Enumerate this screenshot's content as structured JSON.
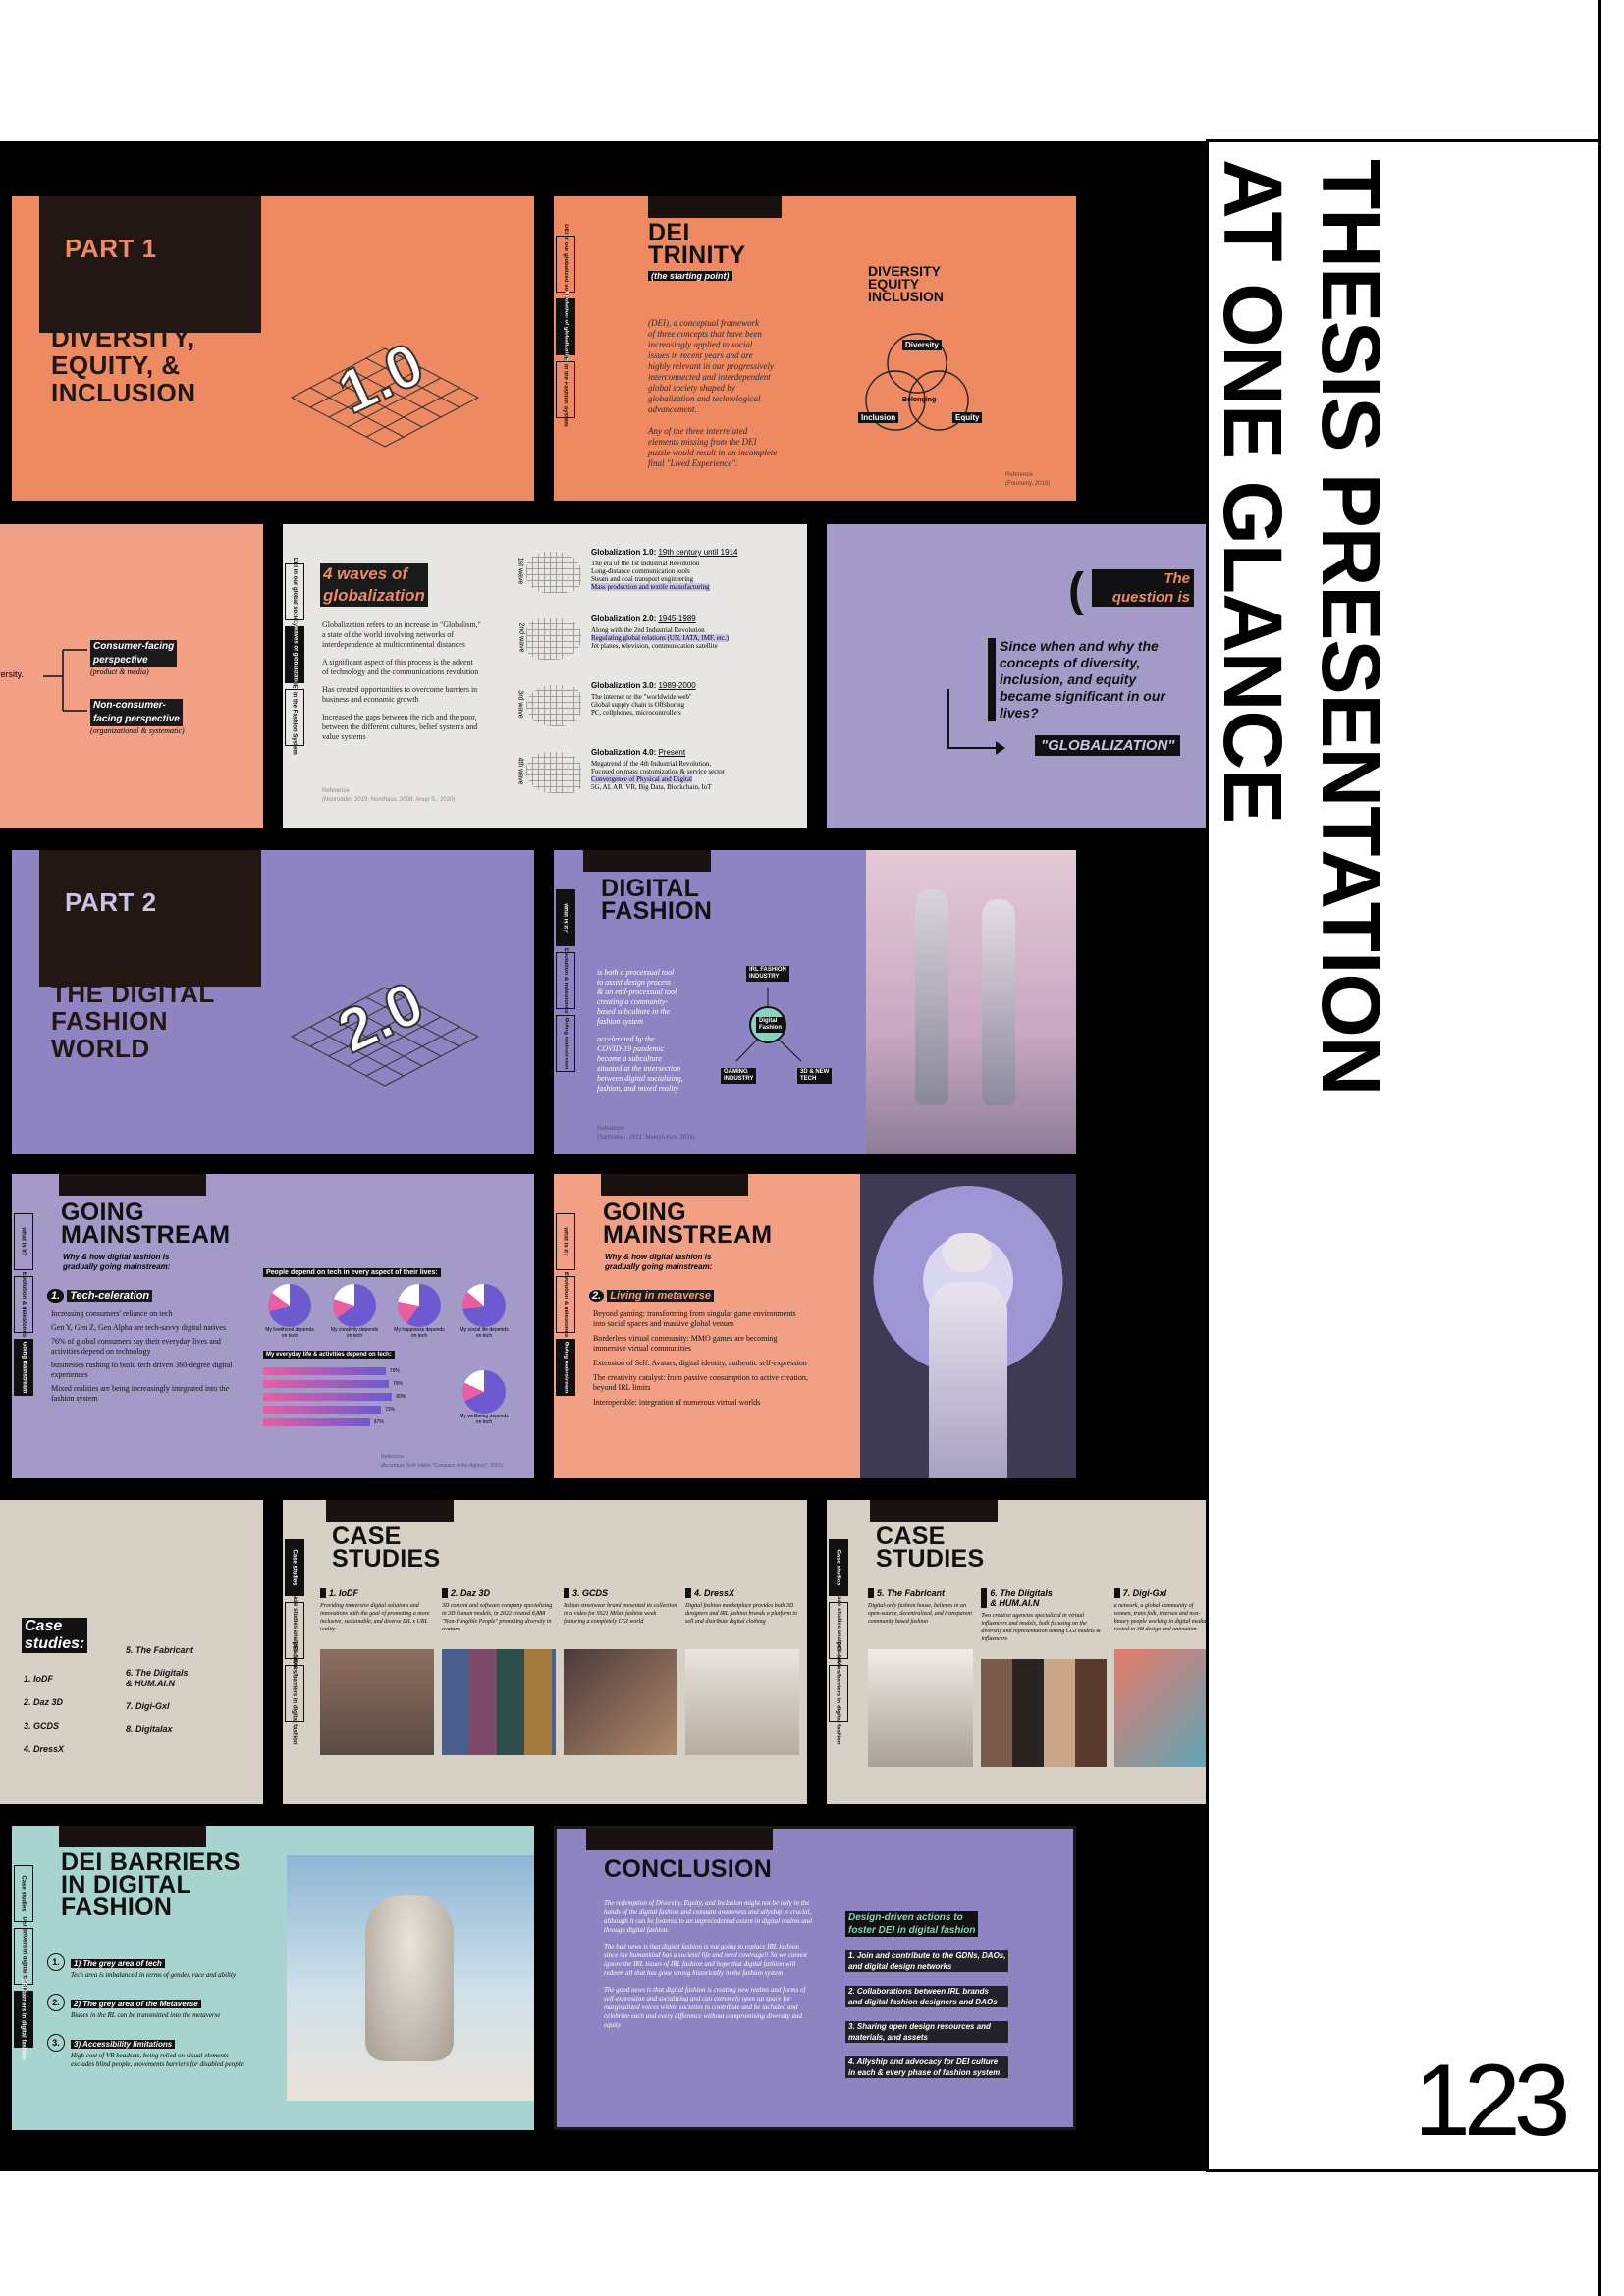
{
  "page": {
    "title_line1": "THESIS PRESENTATION",
    "title_line2": "AT ONE GLANCE",
    "page_number": "123"
  },
  "slides": {
    "s1": {
      "part": "PART 1",
      "title": "DIVERSITY,\nEQUITY, &\nINCLUSION",
      "badge": "1.0"
    },
    "s2": {
      "title": "DEI\nTRINITY",
      "subtitle": "(the starting point)",
      "body": "(DEI), a conceptual framework\nof three concepts that have been\nincreasingly applied to social\nissues in recent years and are\nhighly relevant in our progressively\ninterconnected and interdependent\nglobal society shaped by\nglobalization and technological\nadvancement.\n\nAny of the three interrelated\nelements missing from the DEI\npuzzle would result in an incomplete\nfinal \"Lived Experience\".",
      "logo_lines": [
        "DIVERSITY",
        "EQUITY",
        "INCLUSION"
      ],
      "venn": [
        "Diversity",
        "Belonging",
        "Inclusion",
        "Equity"
      ],
      "source": "Reference\n(Foumeny, 2019)",
      "side_tabs": [
        "DEI in our globalized society",
        "Evolution of globalization",
        "DEI in the Fashion System"
      ]
    },
    "s3": {
      "cut_text": "iversity.",
      "items": [
        {
          "label": "Consumer-facing\nperspective",
          "sub": "(product & media)"
        },
        {
          "label": "Non-consumer-\nfacing perspective",
          "sub": "(organizational & systematic)"
        }
      ]
    },
    "s4": {
      "title": "4 waves of\nglobalization",
      "side_tabs": [
        "DEI in our global society",
        "4 waves of globalization",
        "DEI in the Fashion System"
      ],
      "bullets": [
        "Globalization refers to an increase in \"Globalism,\" a state of the world involving networks of interdependence at multicontinental distances",
        "A significant aspect of this process is the advent of technology and the communications revolution",
        "Has created opportunities to overcome barriers in business and economic growth",
        "Increased the gaps between the rich and the poor, between the different cultures, belief systems and value systems"
      ],
      "source": "Reference\n(Nooruddin, 2019; Nordhaus, 2008; Anup S., 2020)",
      "waves": [
        {
          "label": "1st wave",
          "title": "Globalization 1.0:",
          "date": "19th century until 1914",
          "points": [
            "The era of the 1st Industrial Revolution",
            "Long-distance communication tools",
            "Steam and coal transport engineering",
            "Mass production and textile manufacturing"
          ]
        },
        {
          "label": "2nd wave",
          "title": "Globalization 2.0:",
          "date": "1945-1989",
          "points": [
            "Along with the 2nd Industrial Revolution",
            "Regulating global relations (UN, IATA, IMF, etc.)",
            "Jet planes, television, communication satellite"
          ]
        },
        {
          "label": "3rd wave",
          "title": "Globalization 3.0:",
          "date": "1989-2000",
          "points": [
            "The internet or the \"worldwide web\"",
            "Global supply chain is Offshoring",
            "PC, cellphones, microcontrollers"
          ]
        },
        {
          "label": "4th wave",
          "title": "Globalization 4.0:",
          "date": "Present",
          "points": [
            "Megatrend of the 4th Industrial Revolution,",
            "Focused on mass customization & service sector",
            "Convergence of Physical and Digital",
            "5G, AI, AR, VR, Big Data, Blockchain, IoT"
          ]
        }
      ]
    },
    "s5": {
      "tag": "The\nquestion is",
      "question": "Since when and why the\nconcepts of diversity,\ninclusion, and equity\nbecame significant in our\nlives?",
      "answer": "\"GLOBALIZATION\""
    },
    "s6": {
      "part": "PART 2",
      "title": "THE DIGITAL\nFASHION\nWORLD",
      "badge": "2.0"
    },
    "s7": {
      "title": "DIGITAL\nFASHION",
      "side_tabs": [
        "what is it?",
        "Evolution & milestones",
        "Going mainstream"
      ],
      "b1": "is both a processual tool\nto assist design process\n& an end-processual tool\ncreating a community-\nbased subculture in the\nfashion system",
      "b2": "accelerated by the\nCOVID-19 pandemic\nbecame a subculture\nsituated at the intersection\nbetween digital socializing,\nfashion, and mixed reality",
      "diagram": [
        "IRL FASHION\nINDUSTRY",
        "Digital\nFashion",
        "GAMING\nINDUSTRY",
        "3D & NEW\nTECH"
      ],
      "source": "Reference\n(Sarmakari, 2021; Makryn-Kim, 2016)"
    },
    "s8": {
      "title": "GOING\nMAINSTREAM",
      "subtitle": "Why & how digital fashion is\ngradually going mainstream:",
      "side_tabs": [
        "what is it?",
        "Evolution & milestones",
        "Going mainstream"
      ],
      "num_label": "Tech-celeration",
      "bullets": [
        "Increasing consumers' reliance on tech",
        "Gen Y, Gen Z, Gen Alpha are tech-savvy digital natives",
        "76% of global consumers say their everyday lives and activities depend on technology",
        "businesses rushing to build tech driven 360-degree digital experiences",
        "Mixed realities are being increasingly integrated into the fashion system"
      ],
      "chart_title": "People depend on tech in every aspect of their lives:",
      "donuts": [
        "My livelihood depends on tech",
        "My creativity depends on tech",
        "My happiness depends on tech",
        "My social life depends on tech"
      ],
      "bar_title": "My everyday life & activities depend on tech:",
      "bars": [
        "76%",
        "79%",
        "80%",
        "73%",
        "67%"
      ],
      "wellbeing": "My wellbeing depends on tech",
      "source": "Reference\n(Accenture Tech Vision \"Compass in the Agency\", 2021)"
    },
    "s9": {
      "title": "GOING\nMAINSTREAM",
      "subtitle": "Why & how digital fashion is\ngradually going mainstream:",
      "side_tabs": [
        "what is it?",
        "Evolution & milestones",
        "Going mainstream"
      ],
      "num_label": "Living in metaverse",
      "bullets": [
        "Beyond gaming: transforming from singular game environments into social spaces and massive global venues",
        "Borderless virtual community: MMO games are becoming immersive virtual communities",
        "Extension of Self: Avatars, digital identity, authentic self-expression",
        "The creativity catalyst: from passive consumption to active creation, beyond IRL limits",
        "Interoperable: integration of numerous virtual worlds"
      ]
    },
    "s10": {
      "title": "Case\nstudies:",
      "col1": [
        "1. IoDF",
        "2. Daz 3D",
        "3. GCDS",
        "4. DressX"
      ],
      "col2": [
        "5. The Fabricant",
        "6. The Diigitals\n& HUM.AI.N",
        "7. Digi-Gxl",
        "8. Digitalax"
      ]
    },
    "s11": {
      "title": "CASE\nSTUDIES",
      "side_tabs": [
        "Case studies",
        "Case studies analysis table",
        "DEI drivers/barriers in digital fashion"
      ],
      "cases": [
        {
          "name": "1. IoDF",
          "text": "Providing immersive digital solutions and innovations with the goal of promoting a more inclusive, sustainable, and diverse IRL x URL reality"
        },
        {
          "name": "2. Daz 3D",
          "text": "3D content and software company specializing in 3D human models, in 2022 created 8,888 \"Non-Fungible People\" promoting diversity in avatars"
        },
        {
          "name": "3. GCDS",
          "text": "Italian streetwear brand presented its collection in a video for SS21 Milan fashion week featuring a completely CGI world"
        },
        {
          "name": "4. DressX",
          "text": "Digital fashion marketplace provides both 3D designers and IRL fashion brands a platform to sell and distribute digital clothing"
        }
      ]
    },
    "s12": {
      "title": "CASE\nSTUDIES",
      "side_tabs": [
        "Case studies",
        "Case studies analysis table",
        "DEI drivers/barriers in digital fashion"
      ],
      "cases": [
        {
          "name": "5. The Fabricant",
          "text": "Digital-only fashion house, believes in an open-source, decentralized, and transparent community based fashion"
        },
        {
          "name": "6. The Diigitals\n& HUM.AI.N",
          "text": "Two creative agencies specialized in virtual influencers and models, both focusing on the diversity and representation among CGI models & influencers"
        },
        {
          "name": "7. Digi-Gxl",
          "text": "a network, a global community of women, trans folk, intersex and non-binary people working in digital media, rooted in 3D design and animation"
        }
      ]
    },
    "s13": {
      "title": "DEI BARRIERS\nIN DIGITAL\nFASHION",
      "side_tabs": [
        "Case studies",
        "DEI drivers in digital fashion",
        "DEI barriers in digital fashion"
      ],
      "items": [
        {
          "num": "1.",
          "title": "1) The grey area of tech",
          "text": "Tech area is imbalanced in terms of gender, race and ability"
        },
        {
          "num": "2.",
          "title": "2) The grey area of the Metaverse",
          "text": "Biases in the RL can be transmitted into the metaverse"
        },
        {
          "num": "3.",
          "title": "3) Accessibility limitations",
          "text": "High cost of VR headsets, being relied on visual elements excludes blind people, movements barriers for disabled people"
        }
      ]
    },
    "s14": {
      "title": "CONCLUSION",
      "bullets": [
        "The redemption of Diversity, Equity, and Inclusion might not be only in the hands of the digital fashion and constant awareness and allyship is crucial, although it can be fostered to an unprecedented extent in digital realms and through digital fashion.",
        "The bad news is that digital fashion is not going to replace IRL fashion since the humankind has a societal life and need coverage!! So we cannot ignore the IRL issues of IRL fashion and hope that digital fashion will redeem all that has gone wrong historically in the fashion system",
        "The good news is that digital fashion is creating new realms and forms of self-expression and socializing and can extremely open up space for marginalized voices within societies to contribute and be included and celebrate each and every difference without compromising diversity and equity"
      ],
      "actions_title": "Design-driven actions to\nfoster DEI in digital fashion",
      "actions": [
        "1. Join and contribute to the GDNs, DAOs,\nand digital design networks",
        "2. Collaborations between IRL brands\nand digital fashion designers and DAOs",
        "3. Sharing open design resources and\nmaterials, and assets",
        "4. Allyship and advocacy for DEI culture\nin each & every phase of fashion system"
      ]
    }
  }
}
